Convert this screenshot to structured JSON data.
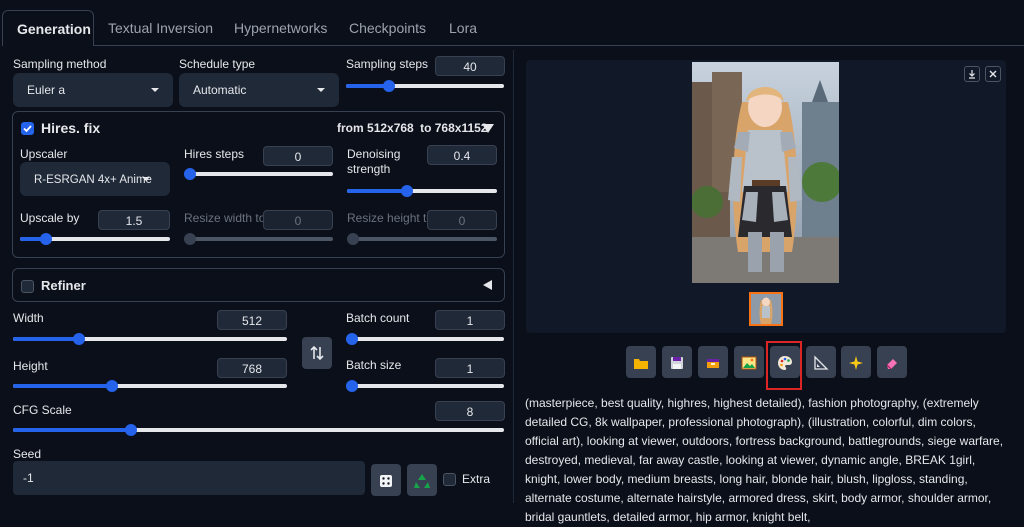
{
  "tabs": [
    {
      "label": "Generation"
    },
    {
      "label": "Textual Inversion"
    },
    {
      "label": "Hypernetworks"
    },
    {
      "label": "Checkpoints"
    },
    {
      "label": "Lora"
    }
  ],
  "sampling": {
    "method_label": "Sampling method",
    "method_value": "Euler a",
    "schedule_label": "Schedule type",
    "schedule_value": "Automatic",
    "steps_label": "Sampling steps",
    "steps_value": "40",
    "steps_fraction": 0.27
  },
  "hires": {
    "title": "Hires. fix",
    "checked": true,
    "summary_prefix": "from",
    "summary_from": "512x768",
    "summary_to_word": "to",
    "summary_to": "768x1152",
    "upscaler_label": "Upscaler",
    "upscaler_value": "R-ESRGAN 4x+ Anime",
    "hires_steps_label": "Hires steps",
    "hires_steps_value": "0",
    "hires_steps_fraction": 0.0,
    "denoise_label_1": "Denoising",
    "denoise_label_2": "strength",
    "denoise_value": "0.4",
    "denoise_fraction": 0.4,
    "upscale_by_label": "Upscale by",
    "upscale_by_value": "1.5",
    "upscale_by_fraction": 0.17,
    "resize_w_label": "Resize width to",
    "resize_w_value": "0",
    "resize_h_label": "Resize height to",
    "resize_h_value": "0"
  },
  "refiner": {
    "title": "Refiner",
    "checked": false
  },
  "size": {
    "width_label": "Width",
    "width_value": "512",
    "width_fraction": 0.24,
    "height_label": "Height",
    "height_value": "768",
    "height_fraction": 0.36,
    "swap_icon": "swap-vertical-icon"
  },
  "batch": {
    "count_label": "Batch count",
    "count_value": "1",
    "count_fraction": 0.0,
    "size_label": "Batch size",
    "size_value": "1",
    "size_fraction": 0.0
  },
  "cfg": {
    "label": "CFG Scale",
    "value": "8",
    "fraction": 0.24
  },
  "seed": {
    "label": "Seed",
    "value": "-1",
    "extra_label": "Extra"
  },
  "toolbar": {
    "buttons": [
      "folder-icon",
      "save-icon",
      "zip-icon",
      "image-icon",
      "palette-icon",
      "ruler-icon",
      "sparkle-icon",
      "eraser-icon"
    ],
    "highlighted": "palette-icon"
  },
  "colors": {
    "accent": "#2563eb",
    "highlight": "#dc2626",
    "thumb_border": "#f97316"
  },
  "prompt_text": "(masterpiece, best quality, highres, highest detailed), fashion photography, (extremely detailed CG, 8k wallpaper, professional photograph), (illustration, colorful, dim colors, official art), looking at viewer, outdoors, fortress background, battlegrounds, siege warfare, destroyed, medieval, far away castle, looking at viewer, dynamic angle, BREAK 1girl, knight, lower body, medium breasts, long hair, blonde hair, blush, lipgloss, standing, alternate costume, alternate hairstyle, armored dress, skirt, body armor, shoulder armor, bridal gauntlets, detailed armor, hip armor, knight belt,"
}
